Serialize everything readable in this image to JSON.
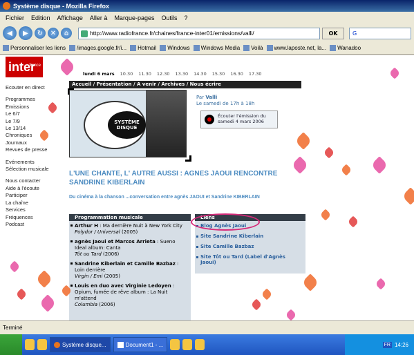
{
  "window": {
    "title": "Système disque - Mozilla Firefox"
  },
  "menu": [
    "Fichier",
    "Edition",
    "Affichage",
    "Aller à",
    "Marque-pages",
    "Outils",
    "?"
  ],
  "nav": {
    "url": "http://www.radiofrance.fr/chaines/france-inter01/emissions/valli/",
    "ok_label": "OK",
    "search_value": "G"
  },
  "bookmarks": [
    "Personnaliser les liens",
    "/images.google.fr/i...",
    "Hotmail",
    "Windows",
    "Windows Media",
    "Voilà",
    "www.laposte.net, la...",
    "Wanadoo"
  ],
  "site": {
    "logo_top": "france",
    "logo": "inter",
    "days": [
      "lundi 6 mars",
      "10.30",
      "11.30",
      "12.30",
      "13.30",
      "14.30",
      "15.30",
      "16.30",
      "17.30"
    ],
    "left_nav": [
      [
        "Ecouter en direct"
      ],
      [
        "Programmes",
        "Emissions",
        "Le 6/7",
        "Le 7/9",
        "Le 13/14",
        "Chroniques",
        "Journaux",
        "Revues de presse"
      ],
      [
        "Evénements",
        "Sélection musicale"
      ],
      [
        "Nous contacter",
        "Aide à l'écoute",
        "Participer",
        "La chaîne",
        "Services",
        "Fréquences",
        "Podcast"
      ]
    ],
    "section_bar": "Accueil / Présentation / A venir / Archives / Nous écrire",
    "header_image_text": "SYSTÈME DISQUE",
    "par_label": "Par",
    "par_name": "Valli",
    "schedule": "Le samedi de 17h à 18h",
    "listen": "Écouter l'émission du samedi 4 mars 2006",
    "headline": "L'UNE CHANTE, L' AUTRE AUSSI : AGNES JAOUI RENCONTRE SANDRINE KIBERLAIN",
    "subtitle": "Du cinéma à la chanson ...conversation entre agnès JAOUI et Sandrine KIBERLAIN",
    "programming": {
      "title": "Programmation musicale",
      "entries": [
        {
          "artist": "Arthur H",
          "track": " : Ma dernière Nuit à New York City",
          "label": "Polydor / Universal",
          "year": " (2005)"
        },
        {
          "artist": "agnès Jaoui et Marcos Arrieta",
          "track": " : Sueno Ideal album: Canta",
          "label": "Tôt ou Tard",
          "year": " (2006)"
        },
        {
          "artist": "Sandrine Kiberlain et Camille Bazbaz",
          "track": " : Loin derrière",
          "label": "Virgin / Emi",
          "year": " (2005)"
        },
        {
          "artist": "Louis en duo avec Virginie Ledoyen",
          "track": " : Opium, fumée de rêve album : La Nuit m'attend",
          "label": "Columbia",
          "year": " (2006)"
        }
      ]
    },
    "links": {
      "title": "Liens",
      "items": [
        "Blog Agnès Jaoui",
        "Site Sandrine Kiberlain",
        "Site Camille Bazbaz",
        "Site Tôt ou Tard (Label d'Agnès Jaoui)"
      ]
    }
  },
  "status": "Terminé",
  "taskbar": {
    "tasks": [
      "Système disque...",
      "Document1 - ..."
    ],
    "lang": "FR",
    "clock": "14:26"
  },
  "colors": {
    "accent_pink": "#d62b7a",
    "link_blue": "#2a5f9c",
    "inter_red": "#cc0000"
  }
}
